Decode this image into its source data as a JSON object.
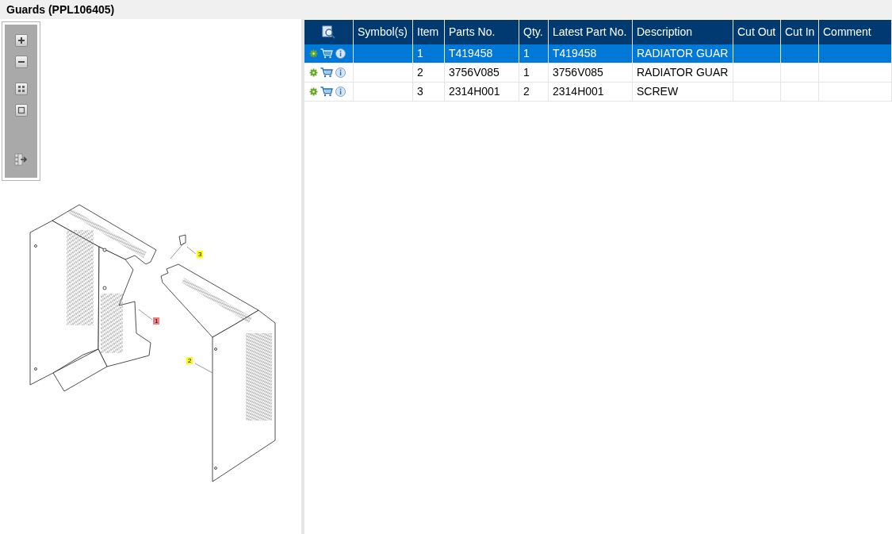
{
  "title": "Guards (PPL106405)",
  "diagram": {
    "callouts": [
      {
        "label": "3",
        "selected": false
      },
      {
        "label": "1",
        "selected": true
      },
      {
        "label": "2",
        "selected": false
      }
    ]
  },
  "table": {
    "columns": [
      "Symbol(s)",
      "Item",
      "Parts No.",
      "Qty.",
      "Latest Part No.",
      "Description",
      "Cut Out",
      "Cut In",
      "Comment"
    ],
    "rows": [
      {
        "selected": true,
        "item": "1",
        "parts_no": "T419458",
        "qty": "1",
        "latest_part_no": "T419458",
        "description": "RADIATOR GUAR"
      },
      {
        "selected": false,
        "item": "2",
        "parts_no": "3756V085",
        "qty": "1",
        "latest_part_no": "3756V085",
        "description": "RADIATOR GUAR"
      },
      {
        "selected": false,
        "item": "3",
        "parts_no": "2314H001",
        "qty": "2",
        "latest_part_no": "2314H001",
        "description": "SCREW"
      }
    ]
  }
}
